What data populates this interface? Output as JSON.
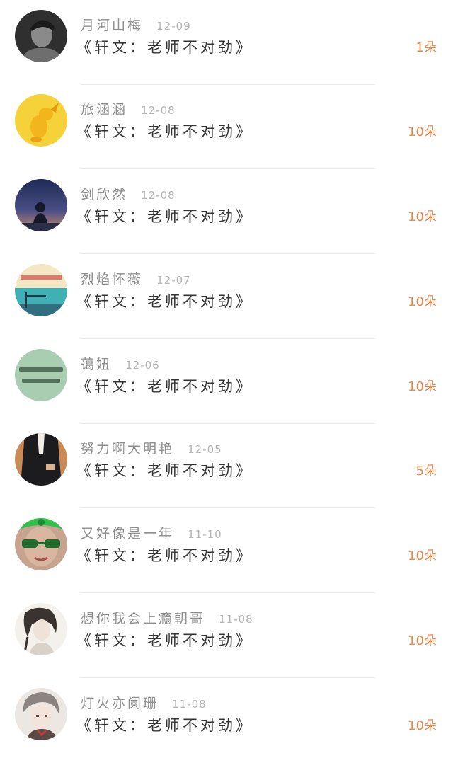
{
  "records": [
    {
      "name": "月河山梅",
      "date": "12-09",
      "title": "《轩文：老师不对劲》",
      "amount": "1朵",
      "avatar": "bw-portrait-icon"
    },
    {
      "name": "旅涵涵",
      "date": "12-08",
      "title": "《轩文：老师不对劲》",
      "amount": "10朵",
      "avatar": "yellow-toy-icon"
    },
    {
      "name": "剑欣然",
      "date": "12-08",
      "title": "《轩文：老师不对劲》",
      "amount": "10朵",
      "avatar": "night-figure-icon"
    },
    {
      "name": "烈焰怀薇",
      "date": "12-07",
      "title": "《轩文：老师不对劲》",
      "amount": "10朵",
      "avatar": "seaside-icon"
    },
    {
      "name": "蔼妞",
      "date": "12-06",
      "title": "《轩文：老师不对劲》",
      "amount": "10朵",
      "avatar": "green-text-icon"
    },
    {
      "name": "努力啊大明艳",
      "date": "12-05",
      "title": "《轩文：老师不对劲》",
      "amount": "5朵",
      "avatar": "suit-figure-icon"
    },
    {
      "name": "又好像是一年",
      "date": "11-10",
      "title": "《轩文：老师不对劲》",
      "amount": "10朵",
      "avatar": "green-sunglasses-icon"
    },
    {
      "name": "想你我会上瘾朝哥",
      "date": "11-08",
      "title": "《轩文：老师不对劲》",
      "amount": "10朵",
      "avatar": "sketch-portrait-icon"
    },
    {
      "name": "灯火亦阑珊",
      "date": "11-08",
      "title": "《轩文：老师不对劲》",
      "amount": "10朵",
      "avatar": "anime-boy-icon"
    }
  ],
  "colors": {
    "name": "#8e8e8e",
    "date": "#b5b5b5",
    "title": "#333333",
    "amount": "#e8894a",
    "divider": "#ececec"
  }
}
